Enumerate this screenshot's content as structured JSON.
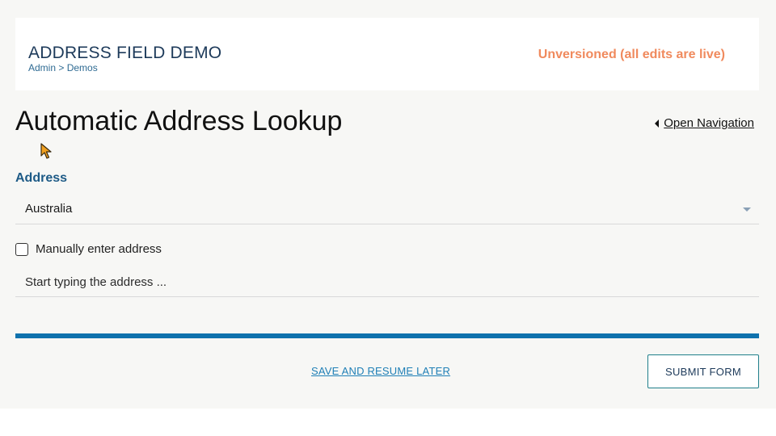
{
  "header": {
    "title": "ADDRESS FIELD DEMO",
    "breadcrumb": [
      "Admin",
      "Demos"
    ],
    "breadcrumb_separator": ">",
    "version_status": "Unversioned (all edits are live)",
    "status_color": "#f08a5d"
  },
  "page": {
    "title": "Automatic Address Lookup",
    "open_navigation_label": "Open Navigation"
  },
  "form": {
    "address_label": "Address",
    "country": {
      "value": "Australia",
      "icon": "chevron-down-icon"
    },
    "manual_entry": {
      "label": "Manually enter address",
      "checked": false
    },
    "address_lookup": {
      "value": "",
      "placeholder": "Start typing the address ..."
    },
    "progress_fraction": 1.0
  },
  "actions": {
    "save_label": "SAVE AND RESUME LATER",
    "submit_label": "SUBMIT FORM"
  },
  "colors": {
    "accent": "#0f72ad",
    "label": "#1d5a86",
    "title": "#1d3a5a"
  }
}
